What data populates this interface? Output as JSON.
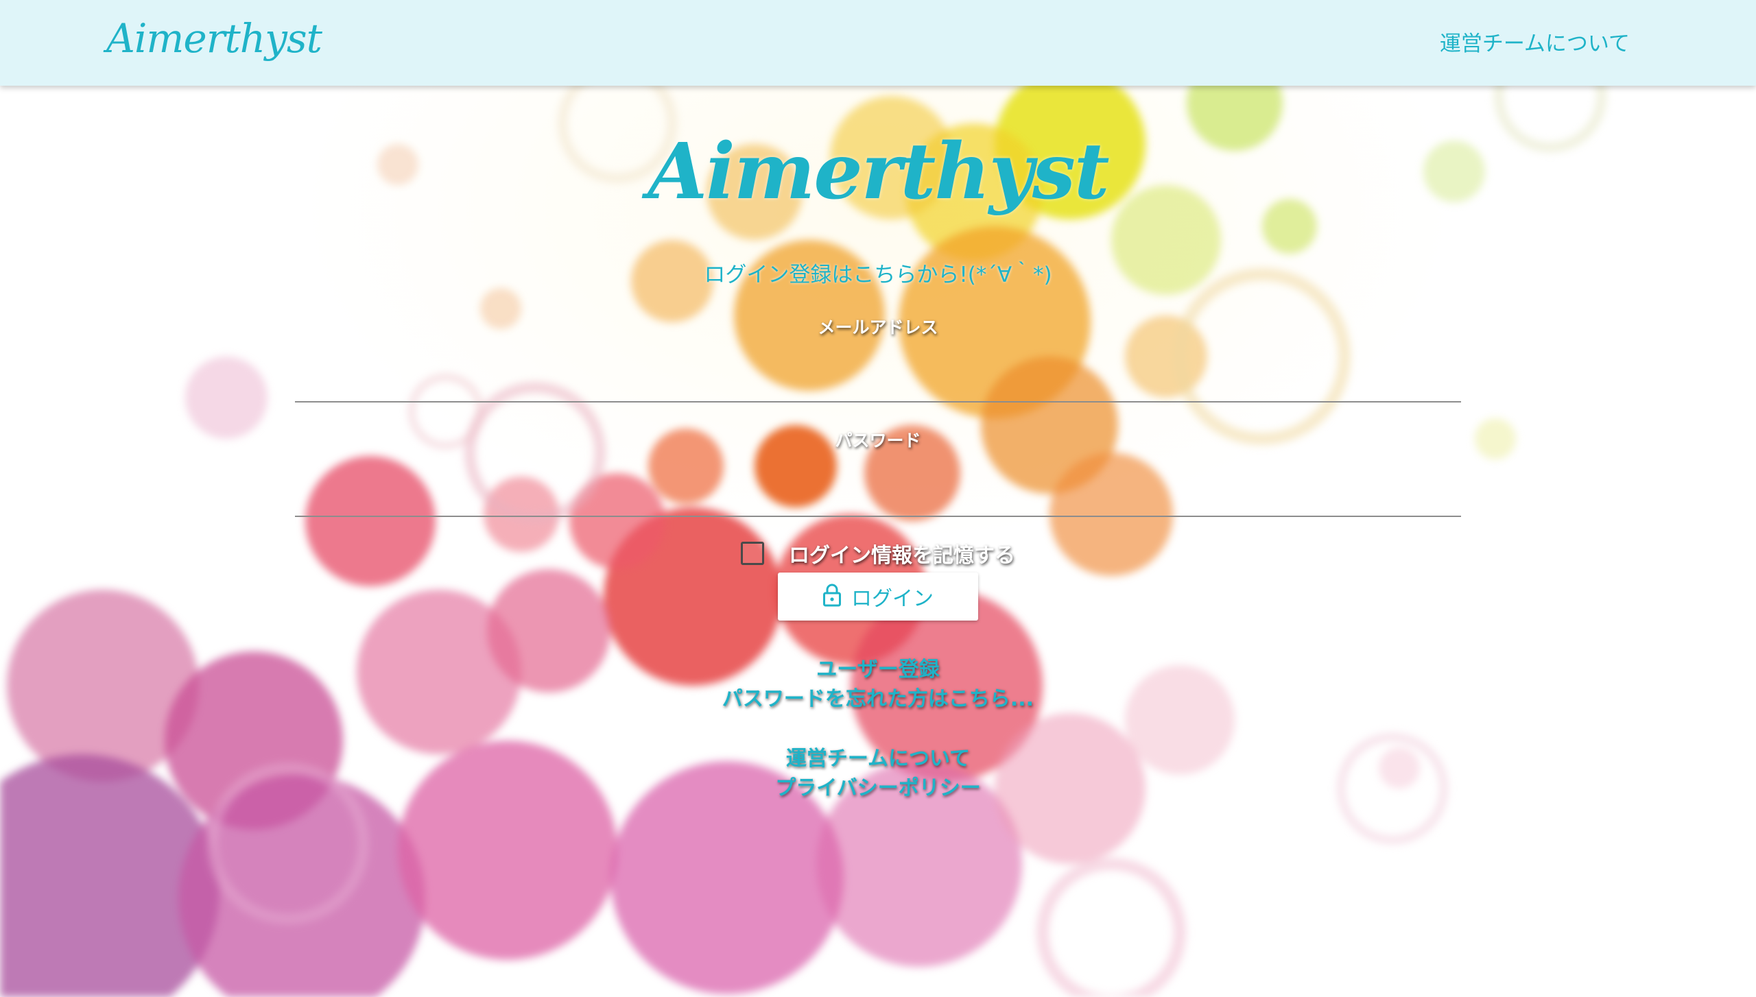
{
  "header": {
    "brand": "Aimerthyst",
    "nav_about": "運営チームについて"
  },
  "main": {
    "brand": "Aimerthyst",
    "subtitle": "ログイン登録はこちらから!(*´∀｀*)",
    "email_label": "メールアドレス",
    "email_value": "",
    "password_label": "パスワード",
    "password_value": "",
    "remember_label": "ログイン情報を記憶する",
    "remember_checked": false,
    "login_button": "ログイン",
    "links": {
      "register": "ユーザー登録",
      "forgot_password": "パスワードを忘れた方はこちら...",
      "about_team": "運営チームについて",
      "privacy": "プライバシーポリシー"
    }
  },
  "icons": {
    "login_button_icon": "lock-icon"
  },
  "colors": {
    "accent": "#1fb3c8",
    "header_bg": "#dff5f9",
    "input_line": "#8d8d8d"
  }
}
